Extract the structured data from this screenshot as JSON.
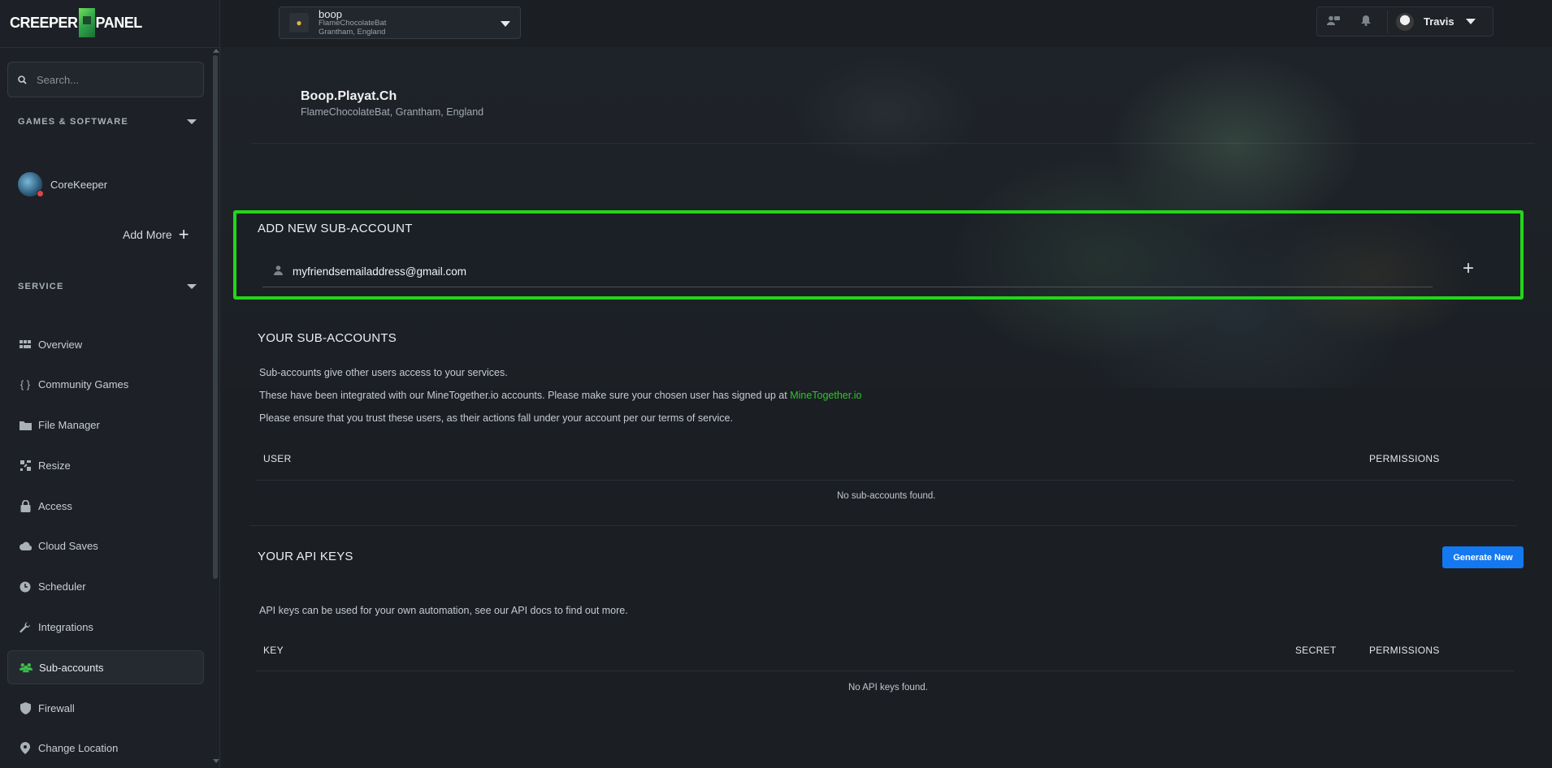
{
  "app": {
    "logo_text_left": "CREEPER",
    "logo_text_right": "PANEL",
    "brand_color": "#2fc52a"
  },
  "sidebar": {
    "search_placeholder": "Search...",
    "games_section": "GAMES & SOFTWARE",
    "game_name": "CoreKeeper",
    "add_more": "Add More",
    "service_section": "SERVICE",
    "items": [
      {
        "label": "Overview",
        "icon": "grid-icon"
      },
      {
        "label": "Community Games",
        "icon": "braces-icon"
      },
      {
        "label": "File Manager",
        "icon": "folder-icon"
      },
      {
        "label": "Resize",
        "icon": "resize-icon"
      },
      {
        "label": "Access",
        "icon": "lock-icon"
      },
      {
        "label": "Cloud Saves",
        "icon": "cloud-icon"
      },
      {
        "label": "Scheduler",
        "icon": "clock-icon"
      },
      {
        "label": "Integrations",
        "icon": "wrench-icon"
      },
      {
        "label": "Sub-accounts",
        "icon": "users-icon",
        "active": true
      },
      {
        "label": "Firewall",
        "icon": "shield-icon"
      },
      {
        "label": "Change Location",
        "icon": "location-pin-icon"
      }
    ]
  },
  "topbar": {
    "server_name": "boop",
    "server_owner": "FlameChocolateBat",
    "server_location": "Grantham, England",
    "user_name": "Travis"
  },
  "header": {
    "title": "Boop.Playat.Ch",
    "subtitle": "FlameChocolateBat, Grantham, England"
  },
  "add_sub_account": {
    "title": "ADD NEW SUB-ACCOUNT",
    "email_value": "myfriendsemailaddress@gmail.com"
  },
  "sub_accounts": {
    "title": "YOUR SUB-ACCOUNTS",
    "line1": "Sub-accounts give other users access to your services.",
    "line2_prefix": "These have been integrated with our MineTogether.io accounts. Please make sure your chosen user has signed up at ",
    "line2_link": "MineTogether.io",
    "line3": "Please ensure that you trust these users, as their actions fall under your account per our terms of service.",
    "col_user": "USER",
    "col_permissions": "PERMISSIONS",
    "empty": "No sub-accounts found."
  },
  "api_keys": {
    "title": "YOUR API KEYS",
    "generate_button": "Generate New",
    "description": "API keys can be used for your own automation, see our API docs to find out more.",
    "col_key": "KEY",
    "col_secret": "SECRET",
    "col_permissions": "PERMISSIONS",
    "empty": "No API keys found."
  }
}
